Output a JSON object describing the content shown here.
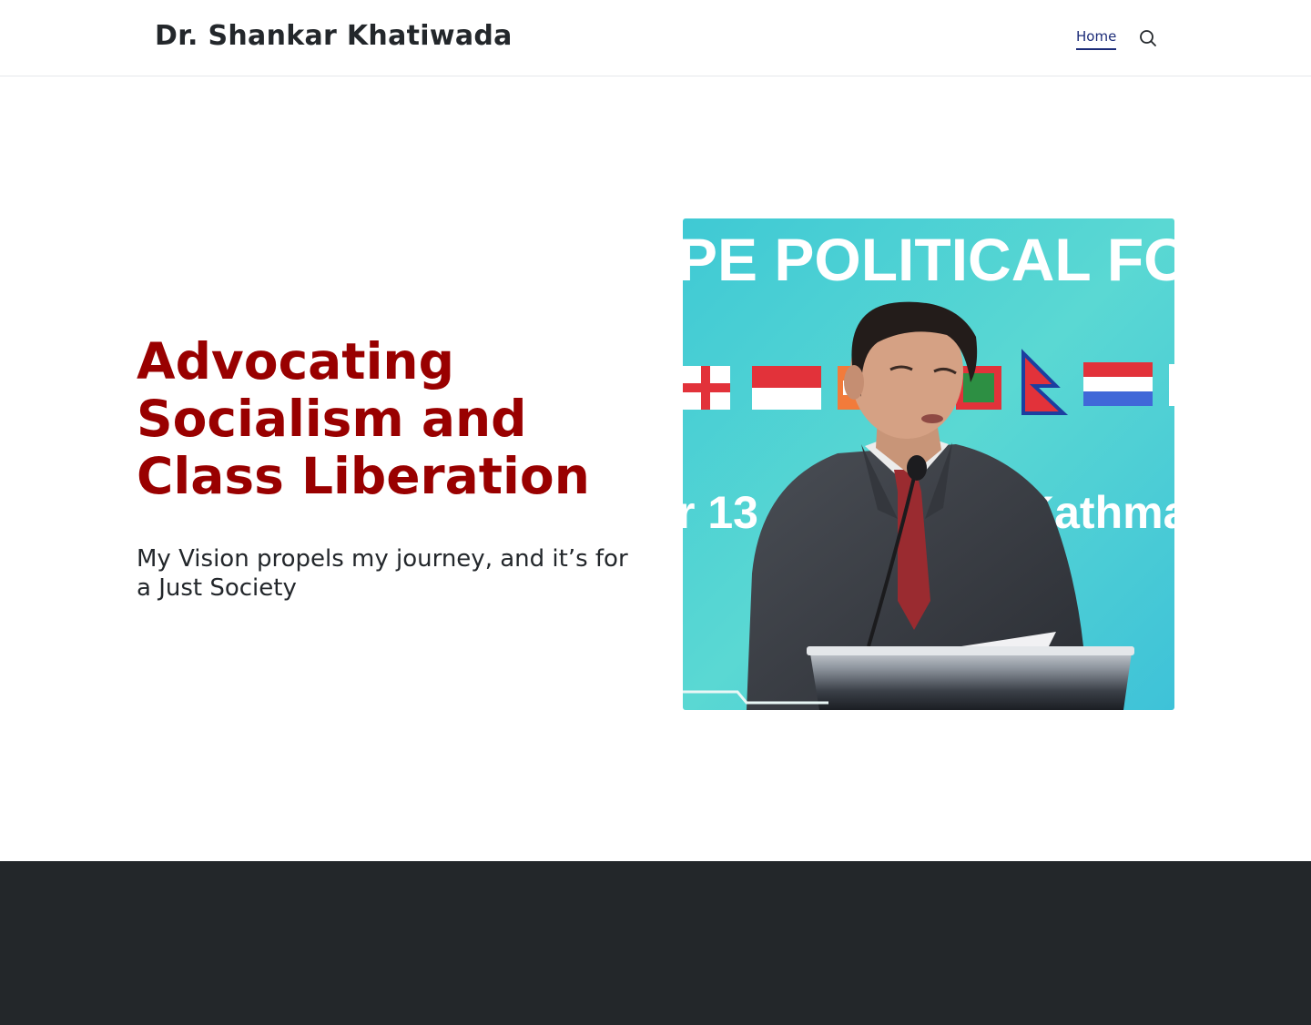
{
  "header": {
    "site_title": "Dr. Shankar Khatiwada",
    "nav": {
      "home_label": "Home"
    },
    "search_icon": "search-icon"
  },
  "hero": {
    "heading": "Advocating Socialism and Class Liberation",
    "subheading": "My Vision propels my journey, and it’s for a Just Society",
    "photo": {
      "banner_text_top": "PE POLITICAL FO",
      "banner_text_bottom_left": "r 13",
      "banner_text_bottom_right": "Kathma"
    }
  },
  "colors": {
    "heading": "#990000",
    "nav_link": "#1c2c78",
    "text": "#23272b",
    "footer": "#23272a",
    "photo_backdrop": "#4fd3d6"
  }
}
